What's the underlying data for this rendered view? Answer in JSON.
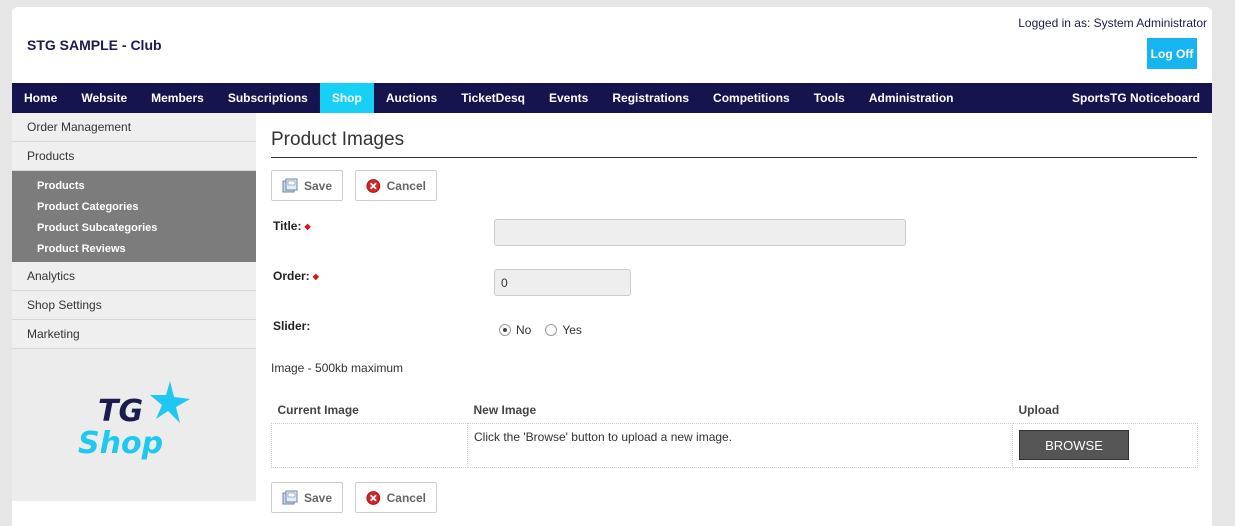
{
  "header": {
    "club_title": "STG SAMPLE - Club",
    "logged_in": "Logged in as: System Administrator",
    "logoff_label": "Log Off"
  },
  "nav": {
    "items": [
      "Home",
      "Website",
      "Members",
      "Subscriptions",
      "Shop",
      "Auctions",
      "TicketDesq",
      "Events",
      "Registrations",
      "Competitions",
      "Tools",
      "Administration"
    ],
    "active": "Shop",
    "right_item": "SportsTG Noticeboard",
    "active_color": "#16d0f5",
    "bg_color": "#16144f"
  },
  "sidebar": {
    "items": [
      "Order Management",
      "Products",
      "Analytics",
      "Shop Settings",
      "Marketing"
    ],
    "sub_items": [
      "Products",
      "Product Categories",
      "Product Subcategories",
      "Product Reviews"
    ],
    "logo_icon": "tg-shop-logo"
  },
  "main": {
    "heading": "Product Images",
    "save_label": "Save",
    "cancel_label": "Cancel",
    "fields": {
      "title_label": "Title:",
      "title_value": "",
      "order_label": "Order:",
      "order_value": "0",
      "slider_label": "Slider:",
      "slider_options": [
        "No",
        "Yes"
      ],
      "slider_selected": "No"
    },
    "image_hint": "Image - 500kb maximum",
    "table": {
      "headers": [
        "Current Image",
        "New Image",
        "Upload"
      ],
      "new_image_text": "Click the 'Browse' button to upload a new image.",
      "browse_label": "BROWSE"
    }
  }
}
